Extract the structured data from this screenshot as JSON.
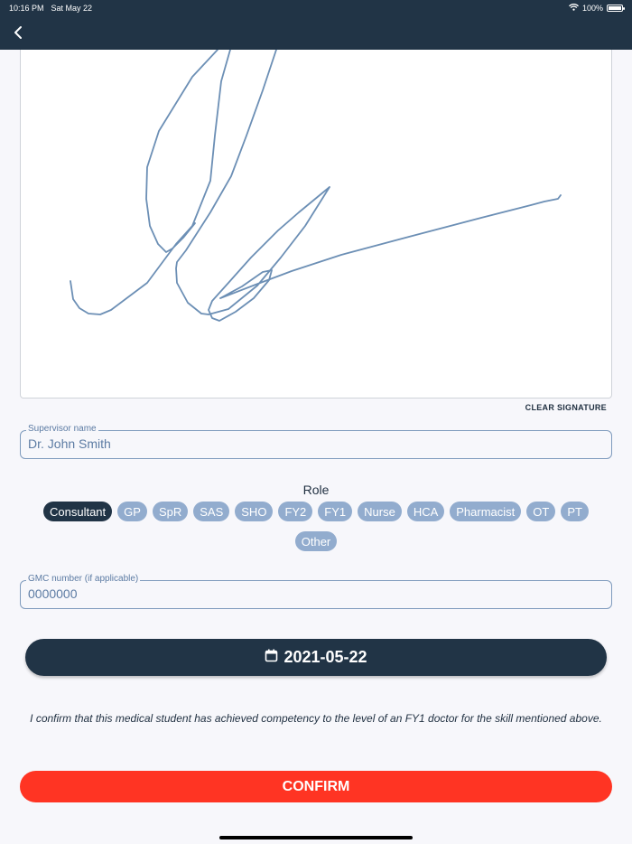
{
  "status_bar": {
    "time": "10:16 PM",
    "date": "Sat May 22",
    "battery": "100%",
    "battery_level": 1.0,
    "icons": [
      "wifi-icon",
      "battery-icon"
    ]
  },
  "nav": {
    "back_icon": "chevron-left-icon"
  },
  "signature": {
    "clear_label": "CLEAR SIGNATURE",
    "stroke_color": "#6c8fb5"
  },
  "supervisor": {
    "label": "Supervisor name",
    "value": "Dr. John Smith"
  },
  "role": {
    "title": "Role",
    "options": [
      "Consultant",
      "GP",
      "SpR",
      "SAS",
      "SHO",
      "FY2",
      "FY1",
      "Nurse",
      "HCA",
      "Pharmacist",
      "OT",
      "PT",
      "Other"
    ],
    "selected": "Consultant"
  },
  "gmc": {
    "label": "GMC number (if applicable)",
    "value": "0000000"
  },
  "date_button": {
    "icon": "calendar-icon",
    "label": "2021-05-22"
  },
  "confirmation_text": "I confirm that this medical student has achieved competency to the level of an FY1 doctor for the skill mentioned above.",
  "confirm_button": {
    "label": "CONFIRM"
  },
  "colors": {
    "navy": "#213446",
    "chip": "#92acce",
    "confirm": "#ff3423",
    "field_border": "#7f9bbd"
  }
}
